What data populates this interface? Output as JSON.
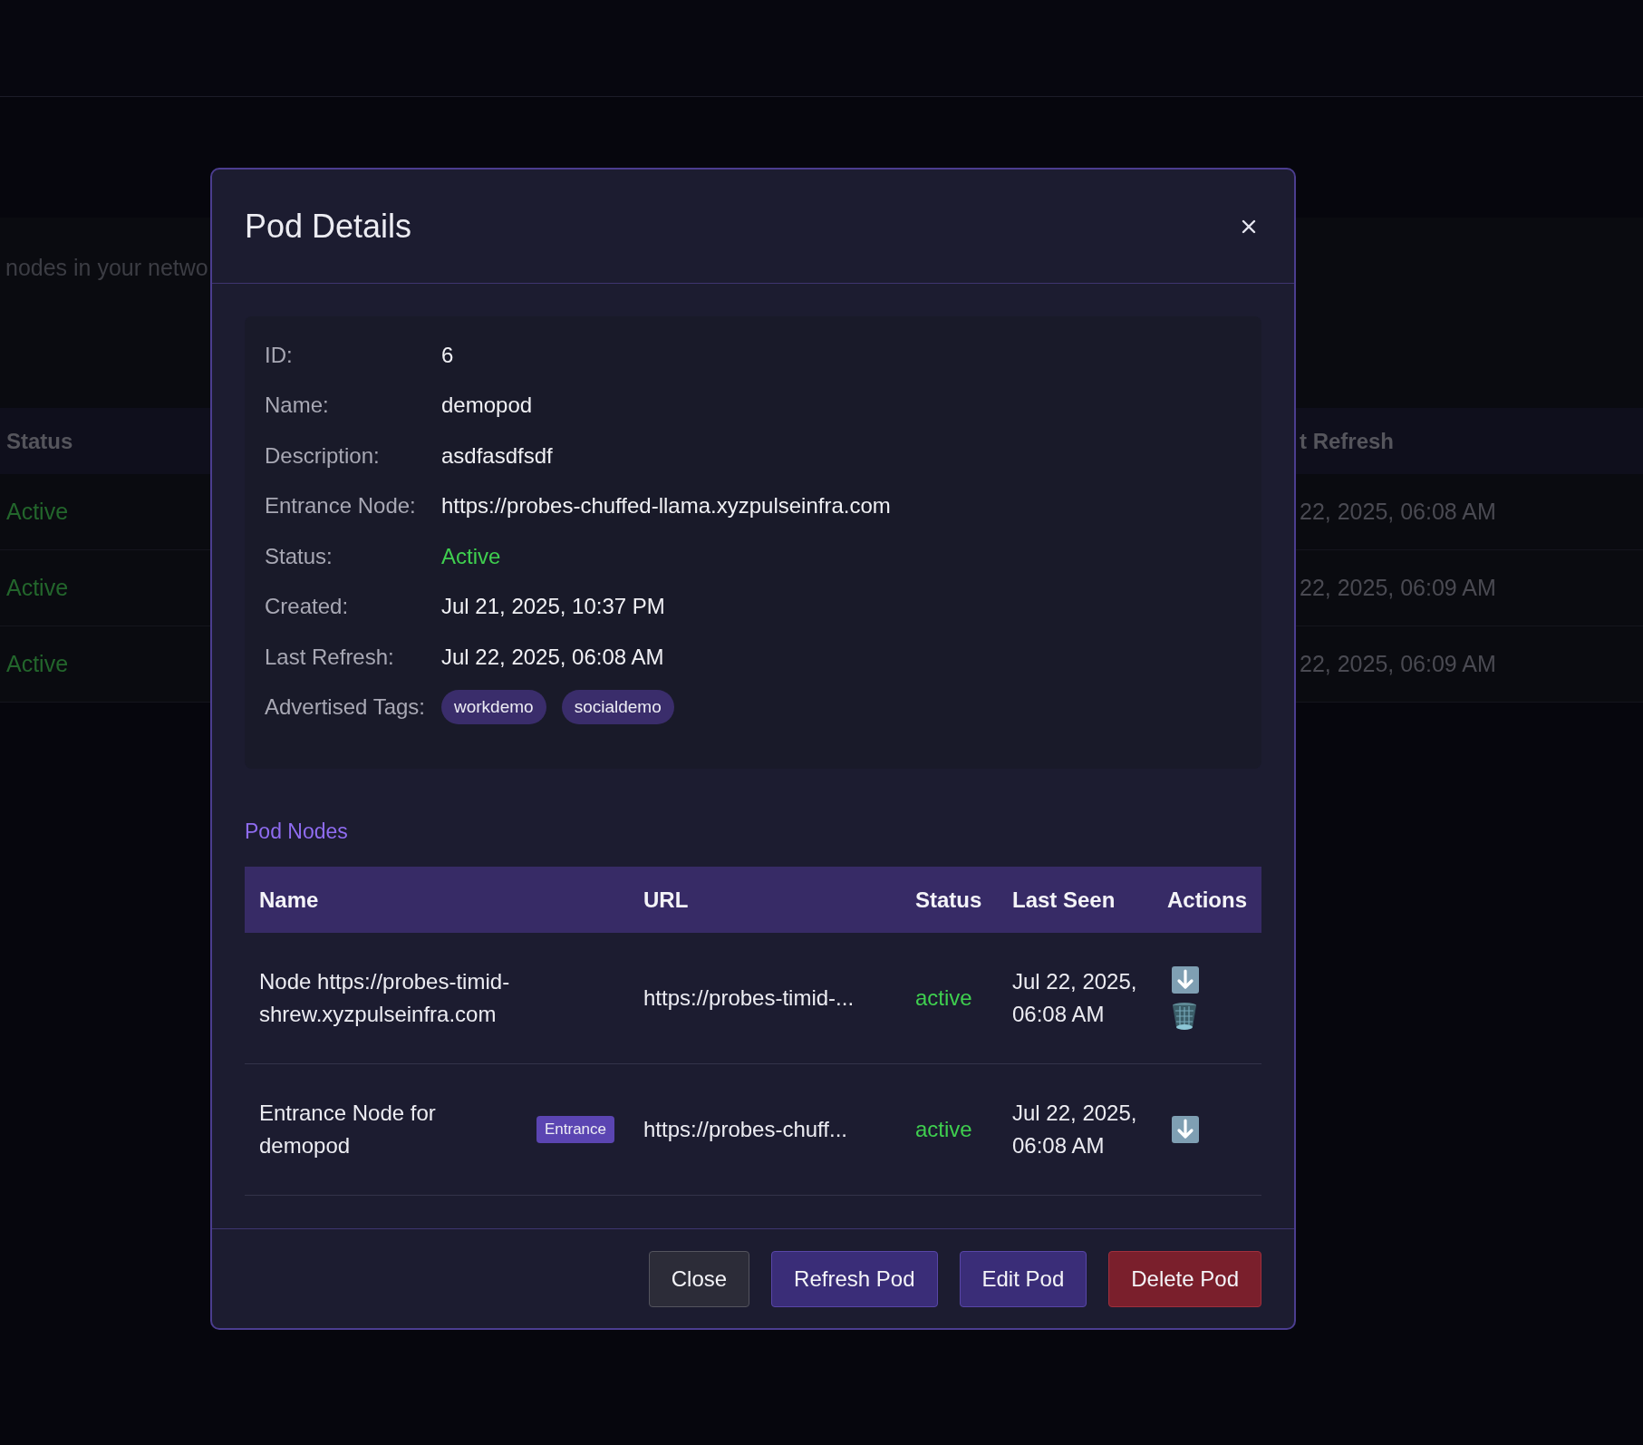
{
  "background": {
    "subtitle": "nodes in your netwo",
    "table": {
      "columns": [
        "Status",
        "t Refresh"
      ],
      "rows": [
        {
          "status": "Active",
          "last_refresh": "22, 2025, 06:08 AM"
        },
        {
          "status": "Active",
          "last_refresh": "22, 2025, 06:09 AM"
        },
        {
          "status": "Active",
          "last_refresh": "22, 2025, 06:09 AM"
        }
      ]
    }
  },
  "modal": {
    "title": "Pod Details",
    "details": [
      {
        "kind": "text",
        "label": "ID:",
        "value": "6"
      },
      {
        "kind": "text",
        "label": "Name:",
        "value": "demopod"
      },
      {
        "kind": "text",
        "label": "Description:",
        "value": "asdfasdfsdf"
      },
      {
        "kind": "text",
        "label": "Entrance Node:",
        "value": "https://probes-chuffed-llama.xyzpulseinfra.com"
      },
      {
        "kind": "status",
        "label": "Status:",
        "value": "Active"
      },
      {
        "kind": "text",
        "label": "Created:",
        "value": "Jul 21, 2025, 10:37 PM"
      },
      {
        "kind": "text",
        "label": "Last Refresh:",
        "value": "Jul 22, 2025, 06:08 AM"
      },
      {
        "kind": "tags",
        "label": "Advertised Tags:",
        "tags": [
          "workdemo",
          "socialdemo"
        ]
      }
    ],
    "nodes": {
      "title": "Pod Nodes",
      "columns": [
        "Name",
        "URL",
        "Status",
        "Last Seen",
        "Actions"
      ],
      "rows": [
        {
          "name": "Node https://probes-timid-shrew.xyzpulseinfra.com",
          "url": "https://probes-timid-...",
          "status": "active",
          "last_seen": "Jul 22, 2025, 06:08 AM",
          "actions": [
            {
              "kind": "download"
            },
            {
              "kind": "delete"
            }
          ]
        },
        {
          "name": "Entrance Node for demopod",
          "badge": "Entrance",
          "url": "https://probes-chuff...",
          "status": "active",
          "last_seen": "Jul 22, 2025, 06:08 AM",
          "actions": [
            {
              "kind": "download"
            }
          ]
        }
      ]
    },
    "buttons": [
      {
        "kind": "secondary",
        "label": "Close"
      },
      {
        "kind": "primary",
        "label": "Refresh Pod"
      },
      {
        "kind": "primary",
        "label": "Edit Pod"
      },
      {
        "kind": "danger",
        "label": "Delete Pod"
      }
    ]
  }
}
